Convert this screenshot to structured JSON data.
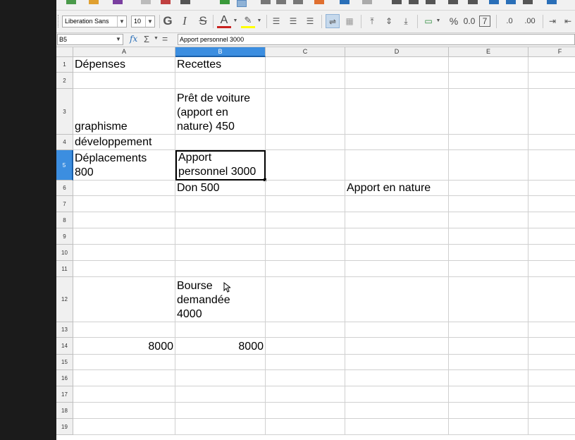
{
  "toolbar": {
    "font_name": "Liberation Sans",
    "font_size": "10",
    "bold_glyph": "G",
    "italic_glyph": "I",
    "strike_glyph": "S",
    "font_color_glyph": "A",
    "percent_glyph": "%",
    "decimal_glyph": "0.0",
    "seven_glyph": "7",
    "add_decimal_glyph": ".0",
    "del_decimal_glyph": ".00"
  },
  "formula_bar": {
    "name_box": "B5",
    "fx": "fx",
    "sigma": "Σ",
    "equals": "=",
    "content": "Apport personnel 3000"
  },
  "columns": [
    "A",
    "B",
    "C",
    "D",
    "E",
    "F"
  ],
  "rows": [
    "1",
    "2",
    "3",
    "4",
    "5",
    "6",
    "7",
    "8",
    "9",
    "10",
    "11",
    "12",
    "13",
    "14",
    "15",
    "16",
    "17",
    "18",
    "19"
  ],
  "cells": {
    "A1": "Dépenses",
    "B1": "Recettes",
    "B3": [
      "Prêt de voiture",
      "(apport en",
      "nature) 450"
    ],
    "A3": "graphisme",
    "A4": "développement",
    "A5": [
      "Déplacements",
      "800"
    ],
    "B5": [
      "Apport",
      "personnel 3000"
    ],
    "B6": "Don 500",
    "D6": "Apport en nature",
    "B12": [
      "Bourse",
      "demandée",
      "4000"
    ],
    "A14": "8000",
    "B14": "8000"
  },
  "selection": {
    "cell": "B5",
    "column": "B",
    "row": "5"
  },
  "colors": {
    "selection_header": "#3c8ee0",
    "toolbar_bg": "#f1f1f1",
    "header_bg": "#f0f0f0"
  }
}
